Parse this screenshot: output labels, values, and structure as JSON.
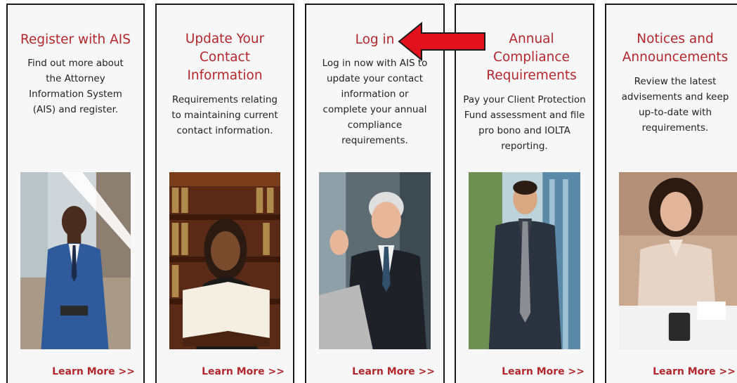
{
  "cards": [
    {
      "title": "Register with AIS",
      "description": "Find out more about the Attorney Information System (AIS) and register.",
      "link": "Learn More >>"
    },
    {
      "title": "Update Your Contact Information",
      "description": "Requirements relating to maintaining current contact information.",
      "link": "Learn More >>"
    },
    {
      "title": "Log in",
      "description": "Log in now with AIS to update your contact information or complete your annual compliance requirements.",
      "link": "Learn More >>"
    },
    {
      "title": "Annual Compliance Requirements",
      "description": "Pay your Client Protection Fund assessment and file pro bono and IOLTA reporting.",
      "link": "Learn More >>"
    },
    {
      "title": "Notices and Announcements",
      "description": "Review the latest advisements and keep up-to-date with requirements.",
      "link": "Learn More >>"
    }
  ],
  "colors": {
    "accent": "#b3272d",
    "arrow": "#e3111b",
    "border": "#1a1a1a"
  }
}
